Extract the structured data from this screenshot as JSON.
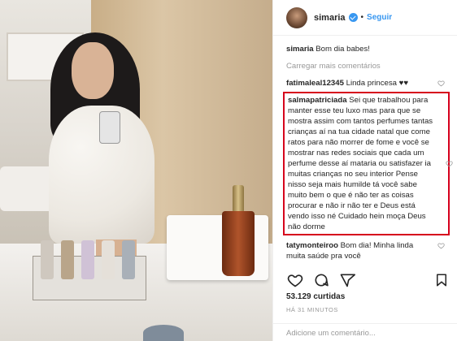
{
  "post": {
    "username": "simaria",
    "follow_label": "Seguir",
    "dot": "•"
  },
  "comments": {
    "caption_user": "simaria",
    "caption_text": "Bom dia babes!",
    "load_more": "Carregar mais comentários",
    "items": [
      {
        "user": "fatimaleal12345",
        "text": "Linda princesa ♥♥"
      },
      {
        "user": "salmapatriciada",
        "text": "Sei que trabalhou para manter esse teu luxo mas para que se mostra assim com tantos perfumes tantas crianças aí na tua cidade natal que come ratos para não morrer de fome e você se mostrar nas redes sociais que cada um perfume desse aí mataria ou satisfazer ia muitas crianças no seu interior Pense nisso seja mais humilde tá você sabe muito bem o que é não ter as coisas procurar e não ir não ter e Deus está vendo isso né Cuidado hein moça Deus não dorme"
      },
      {
        "user": "tatymonteiroo",
        "text": "Bom dia! Minha linda muita saúde pra você"
      }
    ]
  },
  "footer": {
    "likes": "53.129 curtidas",
    "time": "HÁ 31 MINUTOS",
    "add_comment_placeholder": "Adicione um comentário..."
  },
  "icons": [
    "verified-badge-icon",
    "heart-icon",
    "comment-icon",
    "share-icon",
    "bookmark-icon"
  ],
  "colors": {
    "link": "#3897f0",
    "highlight_border": "#d6001c",
    "muted": "#999999"
  }
}
